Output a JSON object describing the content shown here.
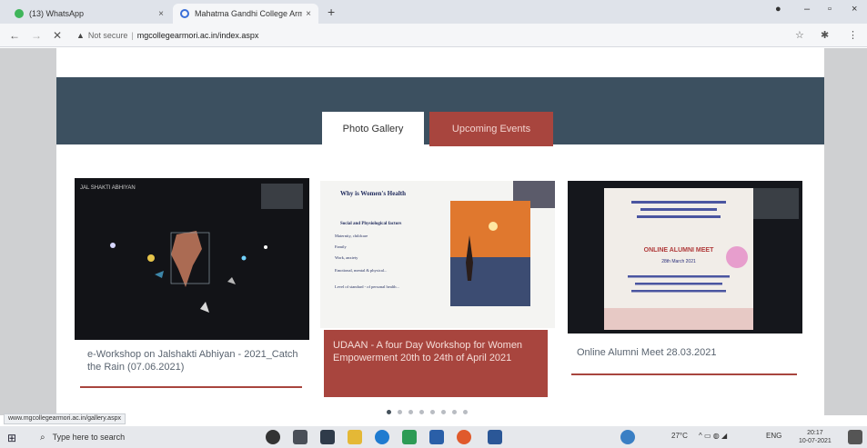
{
  "browser": {
    "tabs": [
      {
        "title": "(13) WhatsApp",
        "close": "×"
      },
      {
        "title": "Mahatma Gandhi College Armori",
        "close": "×"
      }
    ],
    "new_tab": "+",
    "window_controls": {
      "minimize": "–",
      "maximize": "▫",
      "close": "×",
      "profile": "●"
    },
    "nav": {
      "back": "←",
      "forward": "→",
      "reload": "✕"
    },
    "security_icon": "▲",
    "not_secure": "Not secure",
    "url": "mgcollegearmori.ac.in/index.aspx",
    "toolbar_icons": {
      "star": "☆",
      "extensions": "✱",
      "menu": "⋮"
    }
  },
  "page": {
    "tabs": {
      "photo_gallery": "Photo Gallery",
      "upcoming_events": "Upcoming Events"
    },
    "cards": [
      {
        "caption": "e-Workshop on Jalshakti Abhiyan - 2021_Catch the Rain (07.06.2021)",
        "thumb_overlay": "JAL SHAKTI ABHIYAN"
      },
      {
        "caption": "UDAAN - A four Day Workshop for Women Empowerment 20th to 24th of April 2021",
        "slide_title": "Why is Women's Health",
        "slide_subtitle": "Social and Physiological factors",
        "slide_bullets": [
          "Maternity, childcare",
          "Family",
          "Work, anxiety",
          "Emotional, mental & physical...",
          "Level of standard - of personal health..."
        ]
      },
      {
        "caption": "Online Alumni Meet 28.03.2021",
        "poster_title": "ONLINE ALUMNI MEET",
        "poster_date": "28th March 2021"
      }
    ],
    "carousel_dots": 8,
    "status_url": "www.mgcollegearmori.ac.in/gallery.aspx"
  },
  "taskbar": {
    "start": "⊞",
    "search_placeholder": "Type here to search",
    "weather": "27°C",
    "lang": "ENG",
    "time": "20:17",
    "date": "10-07-2021"
  },
  "colors": {
    "accent": "#a8453e",
    "hero": "#3c5060"
  }
}
